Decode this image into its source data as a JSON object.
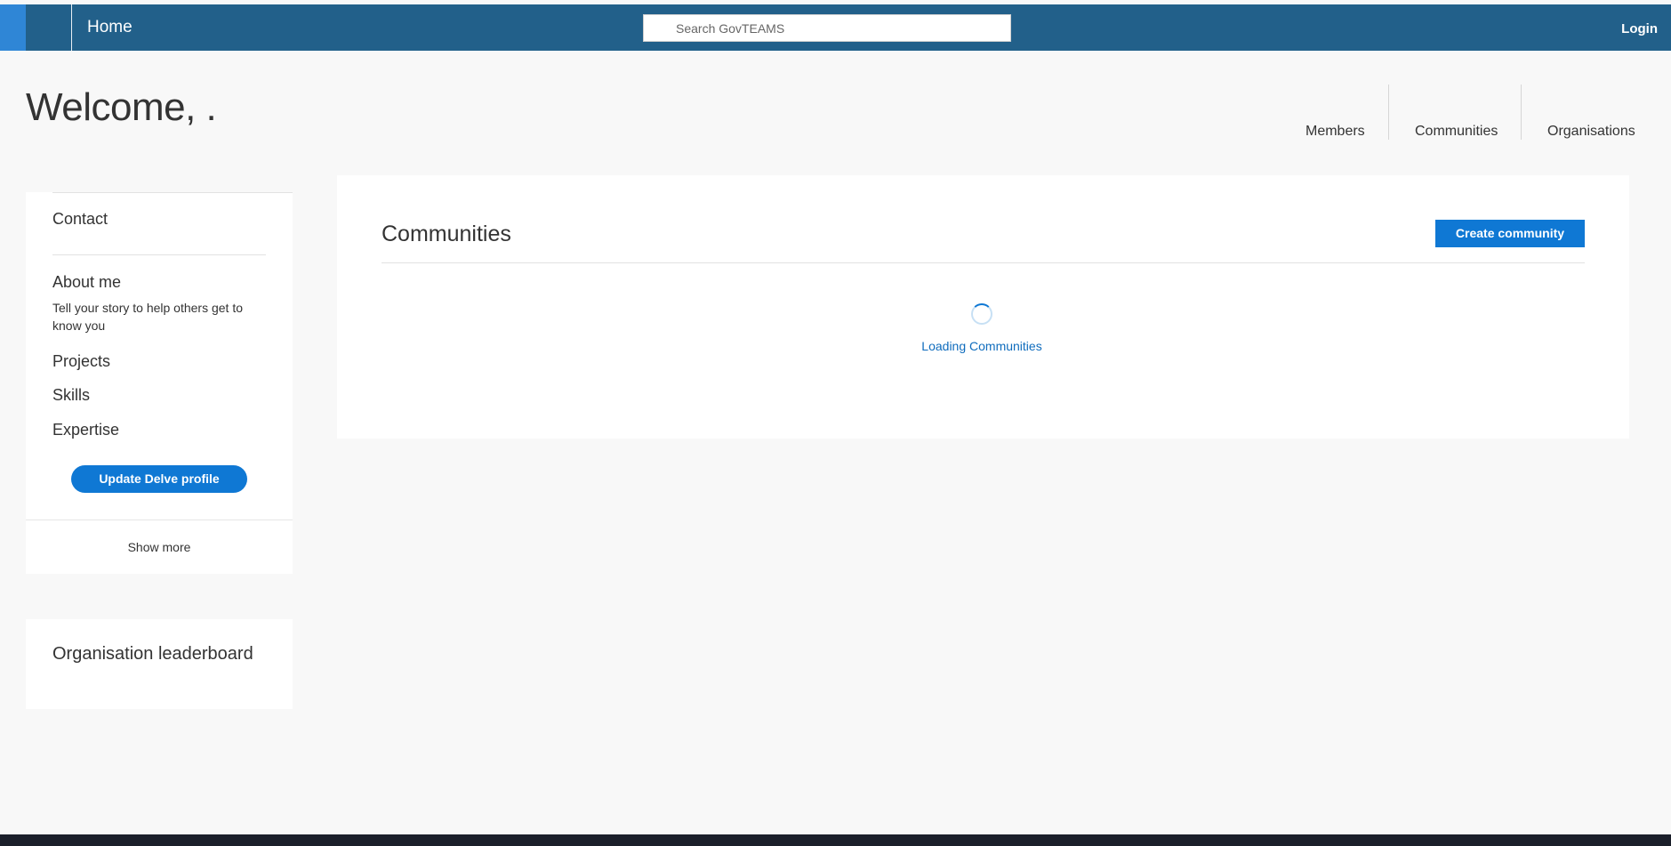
{
  "topbar": {
    "home_label": "Home",
    "search_placeholder": "Search GovTEAMS",
    "login_label": "Login"
  },
  "welcome": {
    "text": "Welcome, ."
  },
  "stats_nav": {
    "tabs": [
      {
        "label": "Members"
      },
      {
        "label": "Communities"
      },
      {
        "label": "Organisations"
      }
    ]
  },
  "profile_card": {
    "contact_label": "Contact",
    "about_label": "About me",
    "about_description": "Tell your story to help others get to know you",
    "projects_label": "Projects",
    "skills_label": "Skills",
    "expertise_label": "Expertise",
    "update_button_label": "Update Delve profile",
    "show_more_label": "Show more"
  },
  "leaderboard": {
    "title": "Organisation leaderboard"
  },
  "communities_panel": {
    "title": "Communities",
    "create_button_label": "Create community",
    "loading_text": "Loading Communities"
  },
  "colors": {
    "header": "#22608a",
    "header_accent": "#2f86d6",
    "primary_button": "#0f78d4",
    "page_background": "#f8f8f8",
    "footer": "#1b1f2a"
  }
}
